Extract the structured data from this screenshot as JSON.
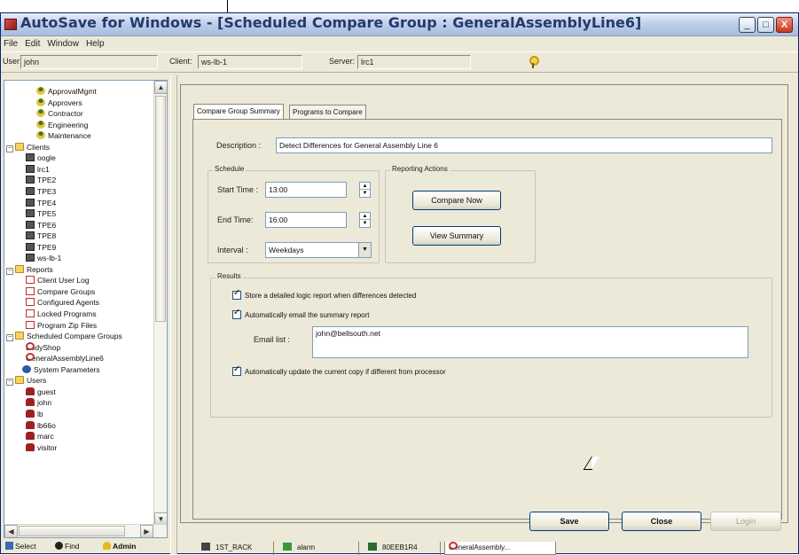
{
  "window": {
    "title": "AutoSave for Windows - [Scheduled Compare Group :  GeneralAssemblyLine6]",
    "controls": {
      "minimize": "_",
      "maximize": "□",
      "close": "X"
    }
  },
  "menu": [
    "File",
    "Edit",
    "Window",
    "Help"
  ],
  "session": {
    "user_label": "User:",
    "user_value": "john",
    "client_label": "Client:",
    "client_value": "ws-lb-1",
    "server_label": "Server:",
    "server_value": "lrc1"
  },
  "tree": {
    "items": [
      {
        "label": "ApprovalMgmt",
        "icon": "person"
      },
      {
        "label": "Approvers",
        "icon": "person"
      },
      {
        "label": "Contractor",
        "icon": "person"
      },
      {
        "label": "Engineering",
        "icon": "person"
      },
      {
        "label": "Maintenance",
        "icon": "person"
      },
      {
        "label": "Clients",
        "icon": "folder",
        "expander": "−"
      },
      {
        "label": "oogle",
        "icon": "pc"
      },
      {
        "label": "lrc1",
        "icon": "pc"
      },
      {
        "label": "TPE2",
        "icon": "pc"
      },
      {
        "label": "TPE3",
        "icon": "pc"
      },
      {
        "label": "TPE4",
        "icon": "pc"
      },
      {
        "label": "TPE5",
        "icon": "pc"
      },
      {
        "label": "TPE6",
        "icon": "pc"
      },
      {
        "label": "TPE8",
        "icon": "pc"
      },
      {
        "label": "TPE9",
        "icon": "pc"
      },
      {
        "label": "ws-lb-1",
        "icon": "pc"
      },
      {
        "label": "Reports",
        "icon": "folder",
        "expander": "−"
      },
      {
        "label": "Client User Log",
        "icon": "report"
      },
      {
        "label": "Compare Groups",
        "icon": "report"
      },
      {
        "label": "Configured Agents",
        "icon": "report"
      },
      {
        "label": "Locked Programs",
        "icon": "report"
      },
      {
        "label": "Program Zip Files",
        "icon": "report"
      },
      {
        "label": "Scheduled Compare Groups",
        "icon": "folder",
        "expander": "−"
      },
      {
        "label": "BodyShop",
        "icon": "group"
      },
      {
        "label": "GeneralAssemblyLine6",
        "icon": "group"
      },
      {
        "label": "System Parameters",
        "icon": "gear"
      },
      {
        "label": "Users",
        "icon": "folder",
        "expander": "−"
      },
      {
        "label": "guest",
        "icon": "user"
      },
      {
        "label": "john",
        "icon": "user"
      },
      {
        "label": "lb",
        "icon": "user"
      },
      {
        "label": "lb66o",
        "icon": "user"
      },
      {
        "label": "marc",
        "icon": "user"
      },
      {
        "label": "visitor",
        "icon": "user"
      }
    ]
  },
  "nav_tabs": [
    {
      "label": "Select",
      "icon": "select"
    },
    {
      "label": "Find",
      "icon": "binoculars"
    },
    {
      "label": "Admin",
      "icon": "admin"
    }
  ],
  "tabs": [
    {
      "label": "Compare Group Summary",
      "active": true
    },
    {
      "label": "Programs to Compare",
      "active": false
    }
  ],
  "form": {
    "description_label": "Description :",
    "description_value": "Detect Differences for General Assembly Line 6",
    "schedule_group": "Schedule",
    "start_label": "Start Time :",
    "start_value": "13:00",
    "end_label": "End Time:",
    "end_value": "16:00",
    "interval_label": "Interval :",
    "interval_value": "Weekdays",
    "reporting_group": "Reporting Actions",
    "compare_now": "Compare Now",
    "view_summary": "View Summary",
    "results_group": "Results",
    "chk_store": "Store a detailed logic report when differences detected",
    "chk_email": "Automatically email the summary report",
    "email_label": "Email list :",
    "email_value": "john@bellsouth.net",
    "chk_update": "Automatically update the current copy if different from processor"
  },
  "buttons": {
    "save": "Save",
    "close": "Close",
    "login": "Login"
  },
  "task_tabs": [
    {
      "label": "1ST_RACK",
      "icon": "rack"
    },
    {
      "label": "alarm",
      "icon": "alarm"
    },
    {
      "label": "80EEB1R4",
      "icon": "rack"
    },
    {
      "label": "GeneralAssembly...",
      "icon": "group"
    }
  ],
  "colors": {
    "titlebar": "#b9cbe8",
    "window": "#ece9d8",
    "accent": "#003c74"
  }
}
